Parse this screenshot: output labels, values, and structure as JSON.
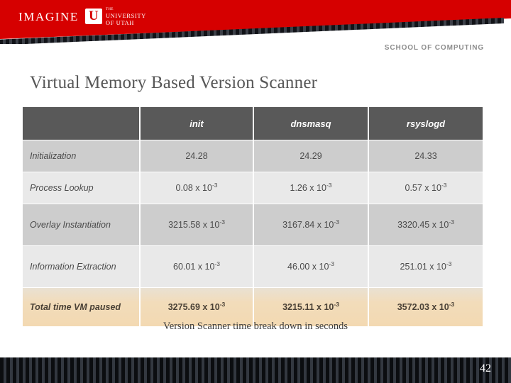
{
  "brand": {
    "imagine_text": "IMAGINE",
    "u_mark": "U",
    "university_line1": "THE",
    "university_line2": "UNIVERSITY",
    "university_line3": "OF UTAH",
    "banner_color": "#d60000"
  },
  "header": {
    "school": "SCHOOL OF COMPUTING"
  },
  "slide": {
    "title": "Virtual Memory Based Version Scanner",
    "caption": "Version Scanner time break down in seconds",
    "page_number": "42"
  },
  "table": {
    "columns": [
      "",
      "init",
      "dnsmasq",
      "rsyslogd"
    ],
    "rows": [
      {
        "label": "Initialization",
        "init": {
          "mantissa": "24.28",
          "exp": ""
        },
        "dnsmasq": {
          "mantissa": "24.29",
          "exp": ""
        },
        "rsyslogd": {
          "mantissa": "24.33",
          "exp": ""
        }
      },
      {
        "label": "Process Lookup",
        "init": {
          "mantissa": "0.08 x 10",
          "exp": "-3"
        },
        "dnsmasq": {
          "mantissa": "1.26 x 10",
          "exp": "-3"
        },
        "rsyslogd": {
          "mantissa": "0.57 x 10",
          "exp": "-3"
        }
      },
      {
        "label": "Overlay Instantiation",
        "init": {
          "mantissa": "3215.58 x 10",
          "exp": "-3"
        },
        "dnsmasq": {
          "mantissa": "3167.84 x 10",
          "exp": "-3"
        },
        "rsyslogd": {
          "mantissa": "3320.45 x 10",
          "exp": "-3"
        }
      },
      {
        "label": "Information Extraction",
        "init": {
          "mantissa": "60.01  x 10",
          "exp": "-3"
        },
        "dnsmasq": {
          "mantissa": "46.00 x 10",
          "exp": "-3"
        },
        "rsyslogd": {
          "mantissa": "251.01 x 10",
          "exp": "-3"
        }
      },
      {
        "label": "Total time VM paused",
        "init": {
          "mantissa": "3275.69 x 10",
          "exp": "-3"
        },
        "dnsmasq": {
          "mantissa": "3215.11 x 10",
          "exp": "-3"
        },
        "rsyslogd": {
          "mantissa": "3572.03 x 10",
          "exp": "-3"
        }
      }
    ]
  }
}
